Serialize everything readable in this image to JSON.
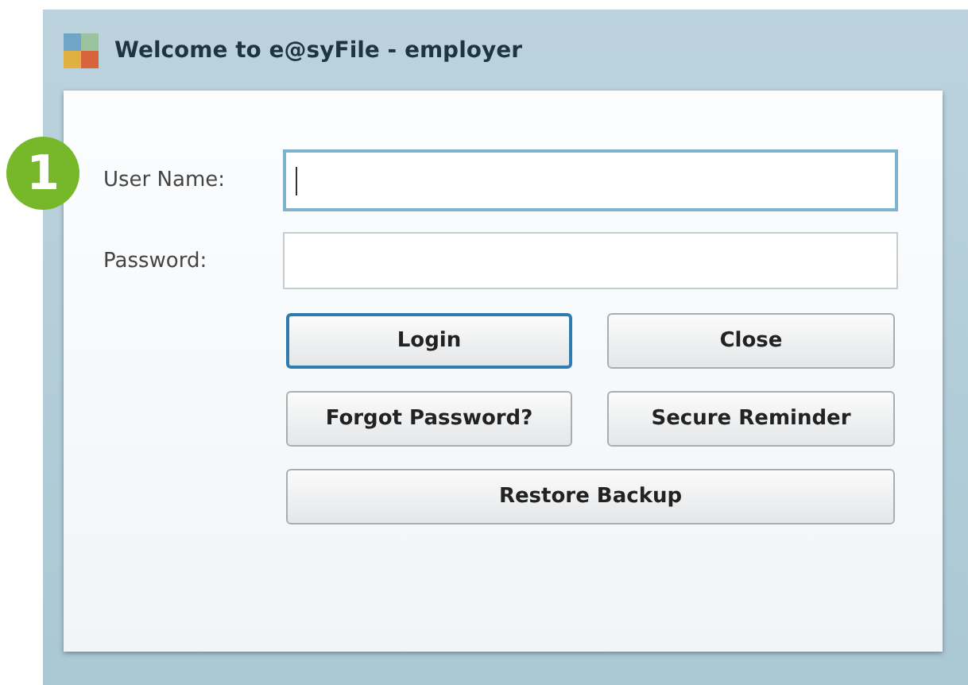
{
  "step_badge": "1",
  "window": {
    "title": "Welcome to e@syFile - employer"
  },
  "fields": [
    {
      "label": "User Name:",
      "focused": true
    },
    {
      "label": "Password:",
      "focused": false
    }
  ],
  "buttons": [
    {
      "label": "Login",
      "default": true,
      "wide": false
    },
    {
      "label": "Close",
      "default": false,
      "wide": false
    },
    {
      "label": "Forgot Password?",
      "default": false,
      "wide": false
    },
    {
      "label": "Secure Reminder",
      "default": false,
      "wide": false
    },
    {
      "label": "Restore Backup",
      "default": false,
      "wide": true
    }
  ]
}
